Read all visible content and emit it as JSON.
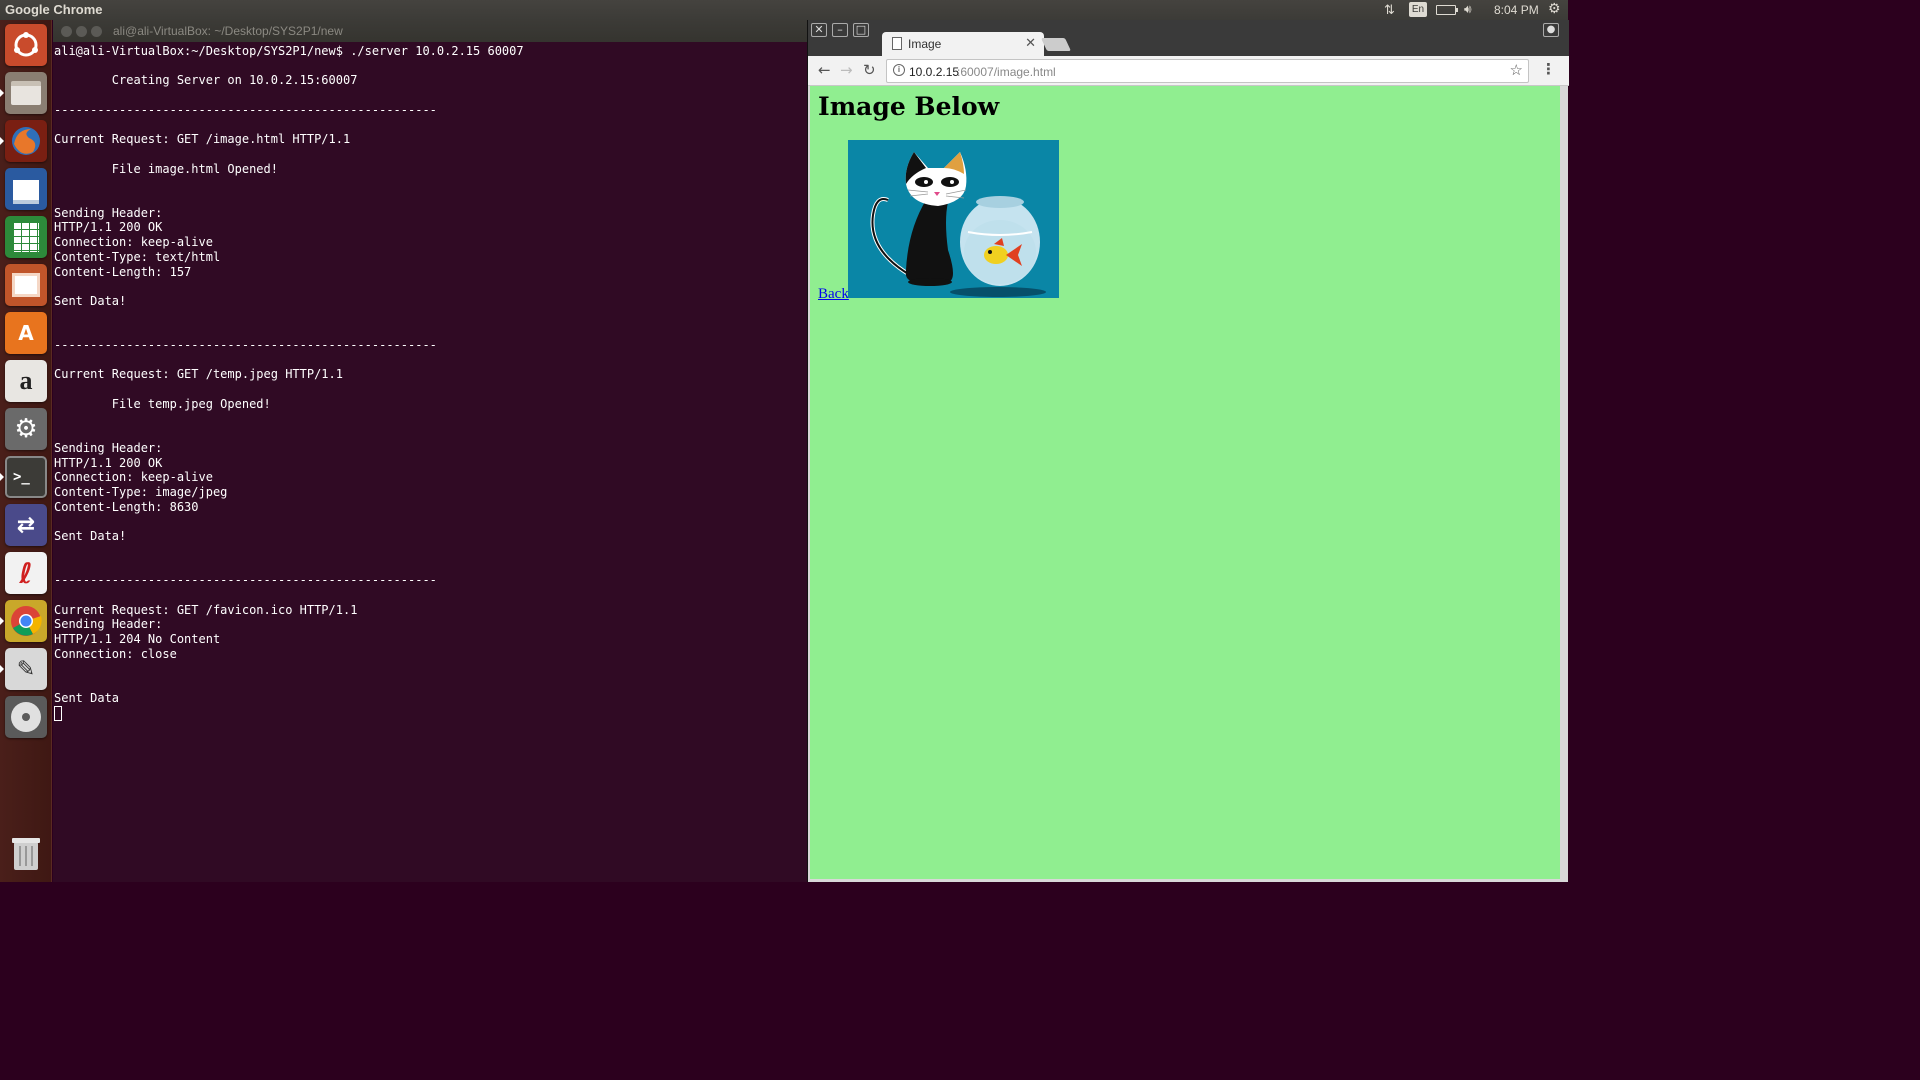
{
  "top_panel": {
    "app_name": "Google Chrome",
    "lang": "En",
    "clock": "8:04 PM"
  },
  "launcher": {
    "items": [
      "ubuntu-dash",
      "files",
      "firefox",
      "libreoffice-writer",
      "libreoffice-calc",
      "libreoffice-impress",
      "software-center",
      "amazon",
      "system-settings",
      "terminal",
      "remote-desktop",
      "text-editor-red",
      "chrome",
      "gedit",
      "dvd",
      "trash"
    ]
  },
  "terminal": {
    "title": "ali@ali-VirtualBox: ~/Desktop/SYS2P1/new",
    "lines": [
      "ali@ali-VirtualBox:~/Desktop/SYS2P1/new$ ./server 10.0.2.15 60007",
      "",
      "        Creating Server on 10.0.2.15:60007",
      "",
      "-----------------------------------------------------",
      "",
      "Current Request: GET /image.html HTTP/1.1",
      "",
      "        File image.html Opened!",
      "",
      "",
      "Sending Header:",
      "HTTP/1.1 200 OK",
      "Connection: keep-alive",
      "Content-Type: text/html",
      "Content-Length: 157",
      "",
      "Sent Data!",
      "",
      "",
      "-----------------------------------------------------",
      "",
      "Current Request: GET /temp.jpeg HTTP/1.1",
      "",
      "        File temp.jpeg Opened!",
      "",
      "",
      "Sending Header:",
      "HTTP/1.1 200 OK",
      "Connection: keep-alive",
      "Content-Type: image/jpeg",
      "Content-Length: 8630",
      "",
      "Sent Data!",
      "",
      "",
      "-----------------------------------------------------",
      "",
      "Current Request: GET /favicon.ico HTTP/1.1",
      "Sending Header:",
      "HTTP/1.1 204 No Content",
      "Connection: close",
      "",
      "",
      "Sent Data"
    ]
  },
  "browser": {
    "tab_title": "Image",
    "url_host": "10.0.2.15",
    "url_rest": ":60007/image.html",
    "page": {
      "heading": "Image Below",
      "link_text": "Back",
      "background_color": "#90ee90",
      "image_alt": "cat-and-fishbowl-image"
    }
  }
}
